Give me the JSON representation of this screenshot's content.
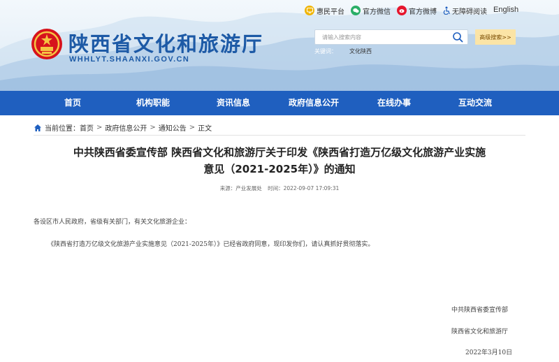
{
  "header": {
    "site_title": "陕西省文化和旅游厅",
    "site_domain": "WHHLYT.SHAANXI.GOV.CN",
    "top_links": [
      {
        "label": "惠民平台",
        "icon": "tv-icon",
        "color": "#f0b400"
      },
      {
        "label": "官方微信",
        "icon": "wechat-icon",
        "color": "#2aae67"
      },
      {
        "label": "官方微博",
        "icon": "weibo-icon",
        "color": "#e6162d"
      },
      {
        "label": "无障碍阅读",
        "icon": "accessibility-icon",
        "color": "#1f5fbf"
      }
    ],
    "english_label": "English",
    "search": {
      "placeholder": "请输入搜索内容"
    },
    "advanced_search_label": "高级搜索>>",
    "keywords_label": "关键词：",
    "keywords": [
      "文化陕西"
    ]
  },
  "nav": {
    "items": [
      "首页",
      "机构职能",
      "资讯信息",
      "政府信息公开",
      "在线办事",
      "互动交流"
    ],
    "bg_color": "#1f5fbf"
  },
  "breadcrumb": {
    "prefix": "当前位置：",
    "items": [
      "首页",
      "政府信息公开",
      "通知公告",
      "正文"
    ]
  },
  "article": {
    "title_line1": "中共陕西省委宣传部 陕西省文化和旅游厅关于印发《陕西省打造万亿级文化旅游产业实施",
    "title_line2": "意见（2021-2025年）》的通知",
    "source_label": "来源：",
    "source": "产业发展处",
    "time_label": "时间：",
    "time": "2022-09-07 17:09:31",
    "greeting": "各设区市人民政府，省级有关部门，有关文化旅游企业：",
    "paragraph1": "《陕西省打造万亿级文化旅游产业实施意见（2021-2025年）》已经省政府同意，现印发你们，请认真抓好贯彻落实。",
    "signature_org1": "中共陕西省委宣传部",
    "signature_org2": "陕西省文化和旅游厅",
    "signature_date": "2022年3月10日"
  }
}
